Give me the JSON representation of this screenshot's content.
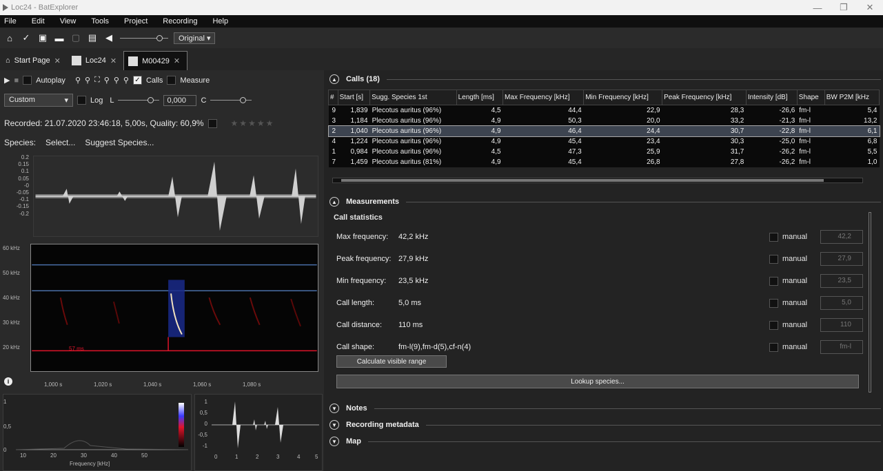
{
  "window": {
    "title": "Loc24 - BatExplorer",
    "minimize": "—",
    "restore": "❐",
    "close": "✕"
  },
  "menu": [
    "File",
    "Edit",
    "View",
    "Tools",
    "Project",
    "Recording",
    "Help"
  ],
  "toolbar": {
    "view_mode": "Original"
  },
  "tabs": [
    {
      "label": "Start Page"
    },
    {
      "label": "Loc24"
    },
    {
      "label": "M00429"
    }
  ],
  "left": {
    "autoplay_label": "Autoplay",
    "calls_label": "Calls",
    "measure_label": "Measure",
    "preset": "Custom",
    "log_label": "Log",
    "l_label": "L",
    "c_label": "C",
    "gain_value": "0,000",
    "recorded_text": "Recorded: 21.07.2020 23:46:18, 5,00s, Quality: 60,9%",
    "stars": "★★★★★",
    "species_label": "Species:",
    "select_label": "Select...",
    "suggest_label": "Suggest Species...",
    "wave_yticks": [
      "0.2",
      "0.15",
      "0.1",
      "0.05",
      "-0",
      "-0.05",
      "-0.1",
      "-0.15",
      "-0.2"
    ],
    "spec_yticks": [
      "60 kHz",
      "50 kHz",
      "40 kHz",
      "30 kHz",
      "20 kHz"
    ],
    "spec_xticks": [
      "1,000 s",
      "1,020 s",
      "1,040 s",
      "1,060 s",
      "1,080 s"
    ],
    "ms_label": "57 ms",
    "pw_yticks": [
      "1",
      "0,5",
      "0"
    ],
    "pw_xticks": [
      "10",
      "20",
      "30",
      "40",
      "50"
    ],
    "pw_xlabel": "Frequency [kHz]",
    "mini_yticks": [
      "1",
      "0,5",
      "0",
      "-0,5",
      "-1"
    ],
    "mini_xticks": [
      "0",
      "1",
      "2",
      "3",
      "4",
      "5"
    ]
  },
  "calls": {
    "title": "Calls (18)",
    "columns": [
      "#",
      "Start [s]",
      "Sugg. Species 1st",
      "Length [ms]",
      "Max Frequency [kHz]",
      "Min Frequency [kHz]",
      "Peak Frequency [kHz]",
      "Intensity [dB]",
      "Shape",
      "BW P2M [kHz"
    ],
    "rows": [
      [
        "9",
        "1,839",
        "Plecotus auritus (96%)",
        "4,5",
        "44,4",
        "22,9",
        "28,3",
        "-26,6",
        "fm-l",
        "5,4"
      ],
      [
        "3",
        "1,184",
        "Plecotus auritus (96%)",
        "4,9",
        "50,3",
        "20,0",
        "33,2",
        "-21,3",
        "fm-l",
        "13,2"
      ],
      [
        "2",
        "1,040",
        "Plecotus auritus (96%)",
        "4,9",
        "46,4",
        "24,4",
        "30,7",
        "-22,8",
        "fm-l",
        "6,1"
      ],
      [
        "4",
        "1,224",
        "Plecotus auritus (96%)",
        "4,9",
        "45,4",
        "23,4",
        "30,3",
        "-25,0",
        "fm-l",
        "6,8"
      ],
      [
        "1",
        "0,984",
        "Plecotus auritus (96%)",
        "4,5",
        "47,3",
        "25,9",
        "31,7",
        "-26,2",
        "fm-l",
        "5,5"
      ],
      [
        "7",
        "1,459",
        "Plecotus auritus (81%)",
        "4,9",
        "45,4",
        "26,8",
        "27,8",
        "-26,2",
        "fm-l",
        "1,0"
      ]
    ],
    "selected_index": 2
  },
  "measurements": {
    "title": "Measurements",
    "subtitle": "Call statistics",
    "manual_label": "manual",
    "items": [
      {
        "label": "Max frequency:",
        "value": "42,2 kHz",
        "spin": "42,2"
      },
      {
        "label": "Peak frequency:",
        "value": "27,9 kHz",
        "spin": "27,9"
      },
      {
        "label": "Min frequency:",
        "value": "23,5 kHz",
        "spin": "23,5"
      },
      {
        "label": "Call length:",
        "value": "5,0 ms",
        "spin": "5,0"
      },
      {
        "label": "Call distance:",
        "value": "110 ms",
        "spin": "110"
      },
      {
        "label": "Call shape:",
        "value": "fm-l(9),fm-d(5),cf-n(4)",
        "spin": "fm-l"
      }
    ],
    "calc_button": "Calculate visible range",
    "lookup_button": "Lookup species..."
  },
  "sections": {
    "notes": "Notes",
    "metadata": "Recording metadata",
    "map": "Map"
  }
}
